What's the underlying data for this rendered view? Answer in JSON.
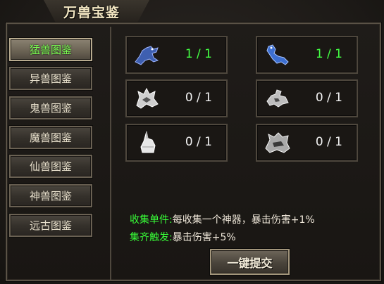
{
  "window": {
    "title": "万兽宝鉴"
  },
  "sidebar": {
    "items": [
      {
        "label": "猛兽图鉴",
        "active": true
      },
      {
        "label": "异兽图鉴",
        "active": false
      },
      {
        "label": "鬼兽图鉴",
        "active": false
      },
      {
        "label": "魔兽图鉴",
        "active": false
      },
      {
        "label": "仙兽图鉴",
        "active": false
      },
      {
        "label": "神兽图鉴",
        "active": false
      },
      {
        "label": "远古图鉴",
        "active": false
      }
    ]
  },
  "slots": [
    {
      "icon": "blue-horse-icon",
      "count": "1 / 1",
      "collected": true
    },
    {
      "icon": "blue-beast-icon",
      "count": "1 / 1",
      "collected": true
    },
    {
      "icon": "white-dragon-icon",
      "count": "0 / 1",
      "collected": false
    },
    {
      "icon": "white-lizard-icon",
      "count": "0 / 1",
      "collected": false
    },
    {
      "icon": "white-unicorn-icon",
      "count": "0 / 1",
      "collected": false
    },
    {
      "icon": "white-wolf-icon",
      "count": "0 / 1",
      "collected": false
    }
  ],
  "info": {
    "collect_single_key": "收集单件:",
    "collect_single_value": "每收集一个神器，暴击伤害+1%",
    "collect_all_key": "集齐触发:",
    "collect_all_value": "暴击伤害+5%"
  },
  "submit": {
    "label": "一键提交"
  },
  "colors": {
    "accent_green": "#38ff38",
    "active_tab_text": "#7cff53",
    "text": "#f0e8da"
  }
}
